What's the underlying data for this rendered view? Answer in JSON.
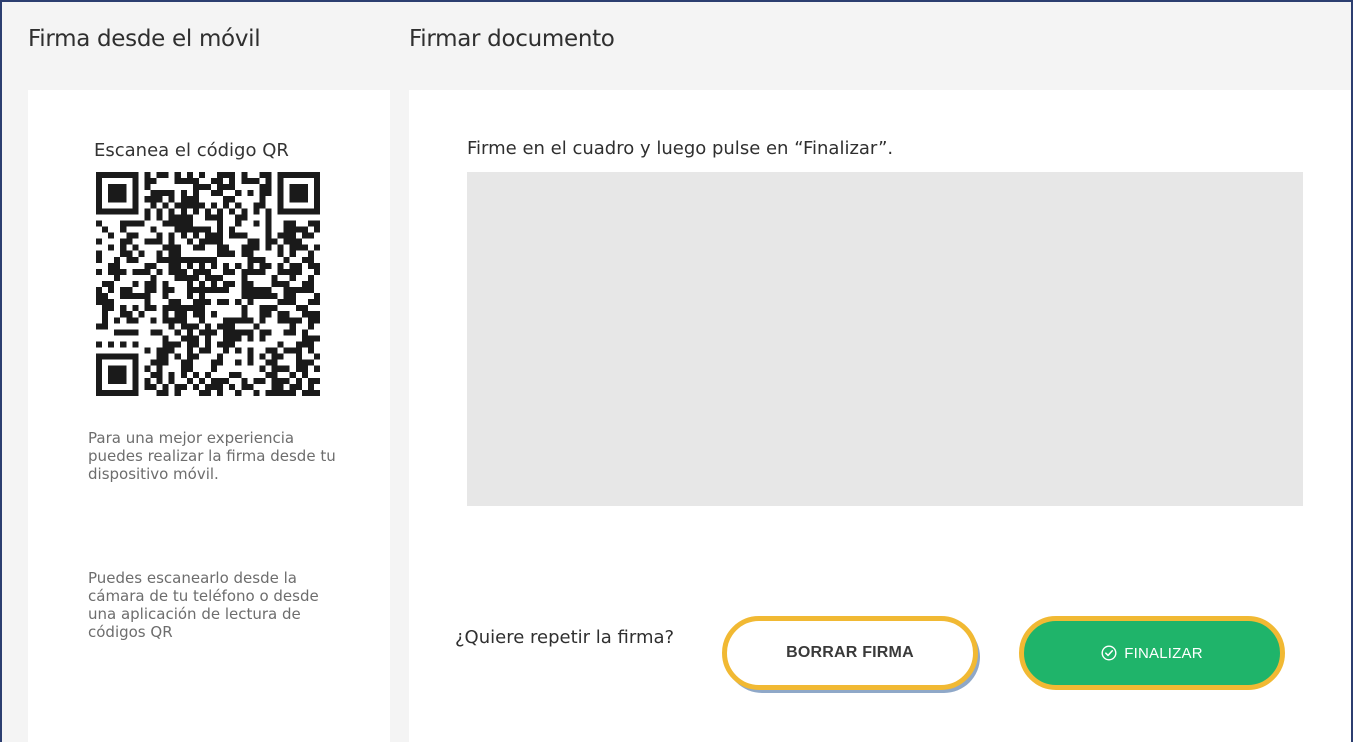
{
  "header": {
    "left_title": "Firma desde el móvil",
    "right_title": "Firmar documento"
  },
  "qr_panel": {
    "title": "Escanea el código QR",
    "qr_icon": "qr-code-icon",
    "info_1": "Para una mejor experiencia puedes realizar la firma desde tu dispositivo móvil.",
    "info_2": "Puedes escanearlo desde la cámara de tu teléfono o desde una aplicación de lectura de códigos QR"
  },
  "signature_panel": {
    "instruction": "Firme en el cuadro y luego pulse en “Finalizar”.",
    "repeat_question": "¿Quiere repetir la firma?",
    "clear_button": "BORRAR FIRMA",
    "finish_button": "FINALIZAR",
    "finish_icon": "check-circle-icon"
  },
  "colors": {
    "finish_button_bg": "#1fb46a",
    "highlight_border": "#f1b933",
    "signature_box_bg": "#e7e7e7",
    "page_bg": "#f4f4f4"
  }
}
